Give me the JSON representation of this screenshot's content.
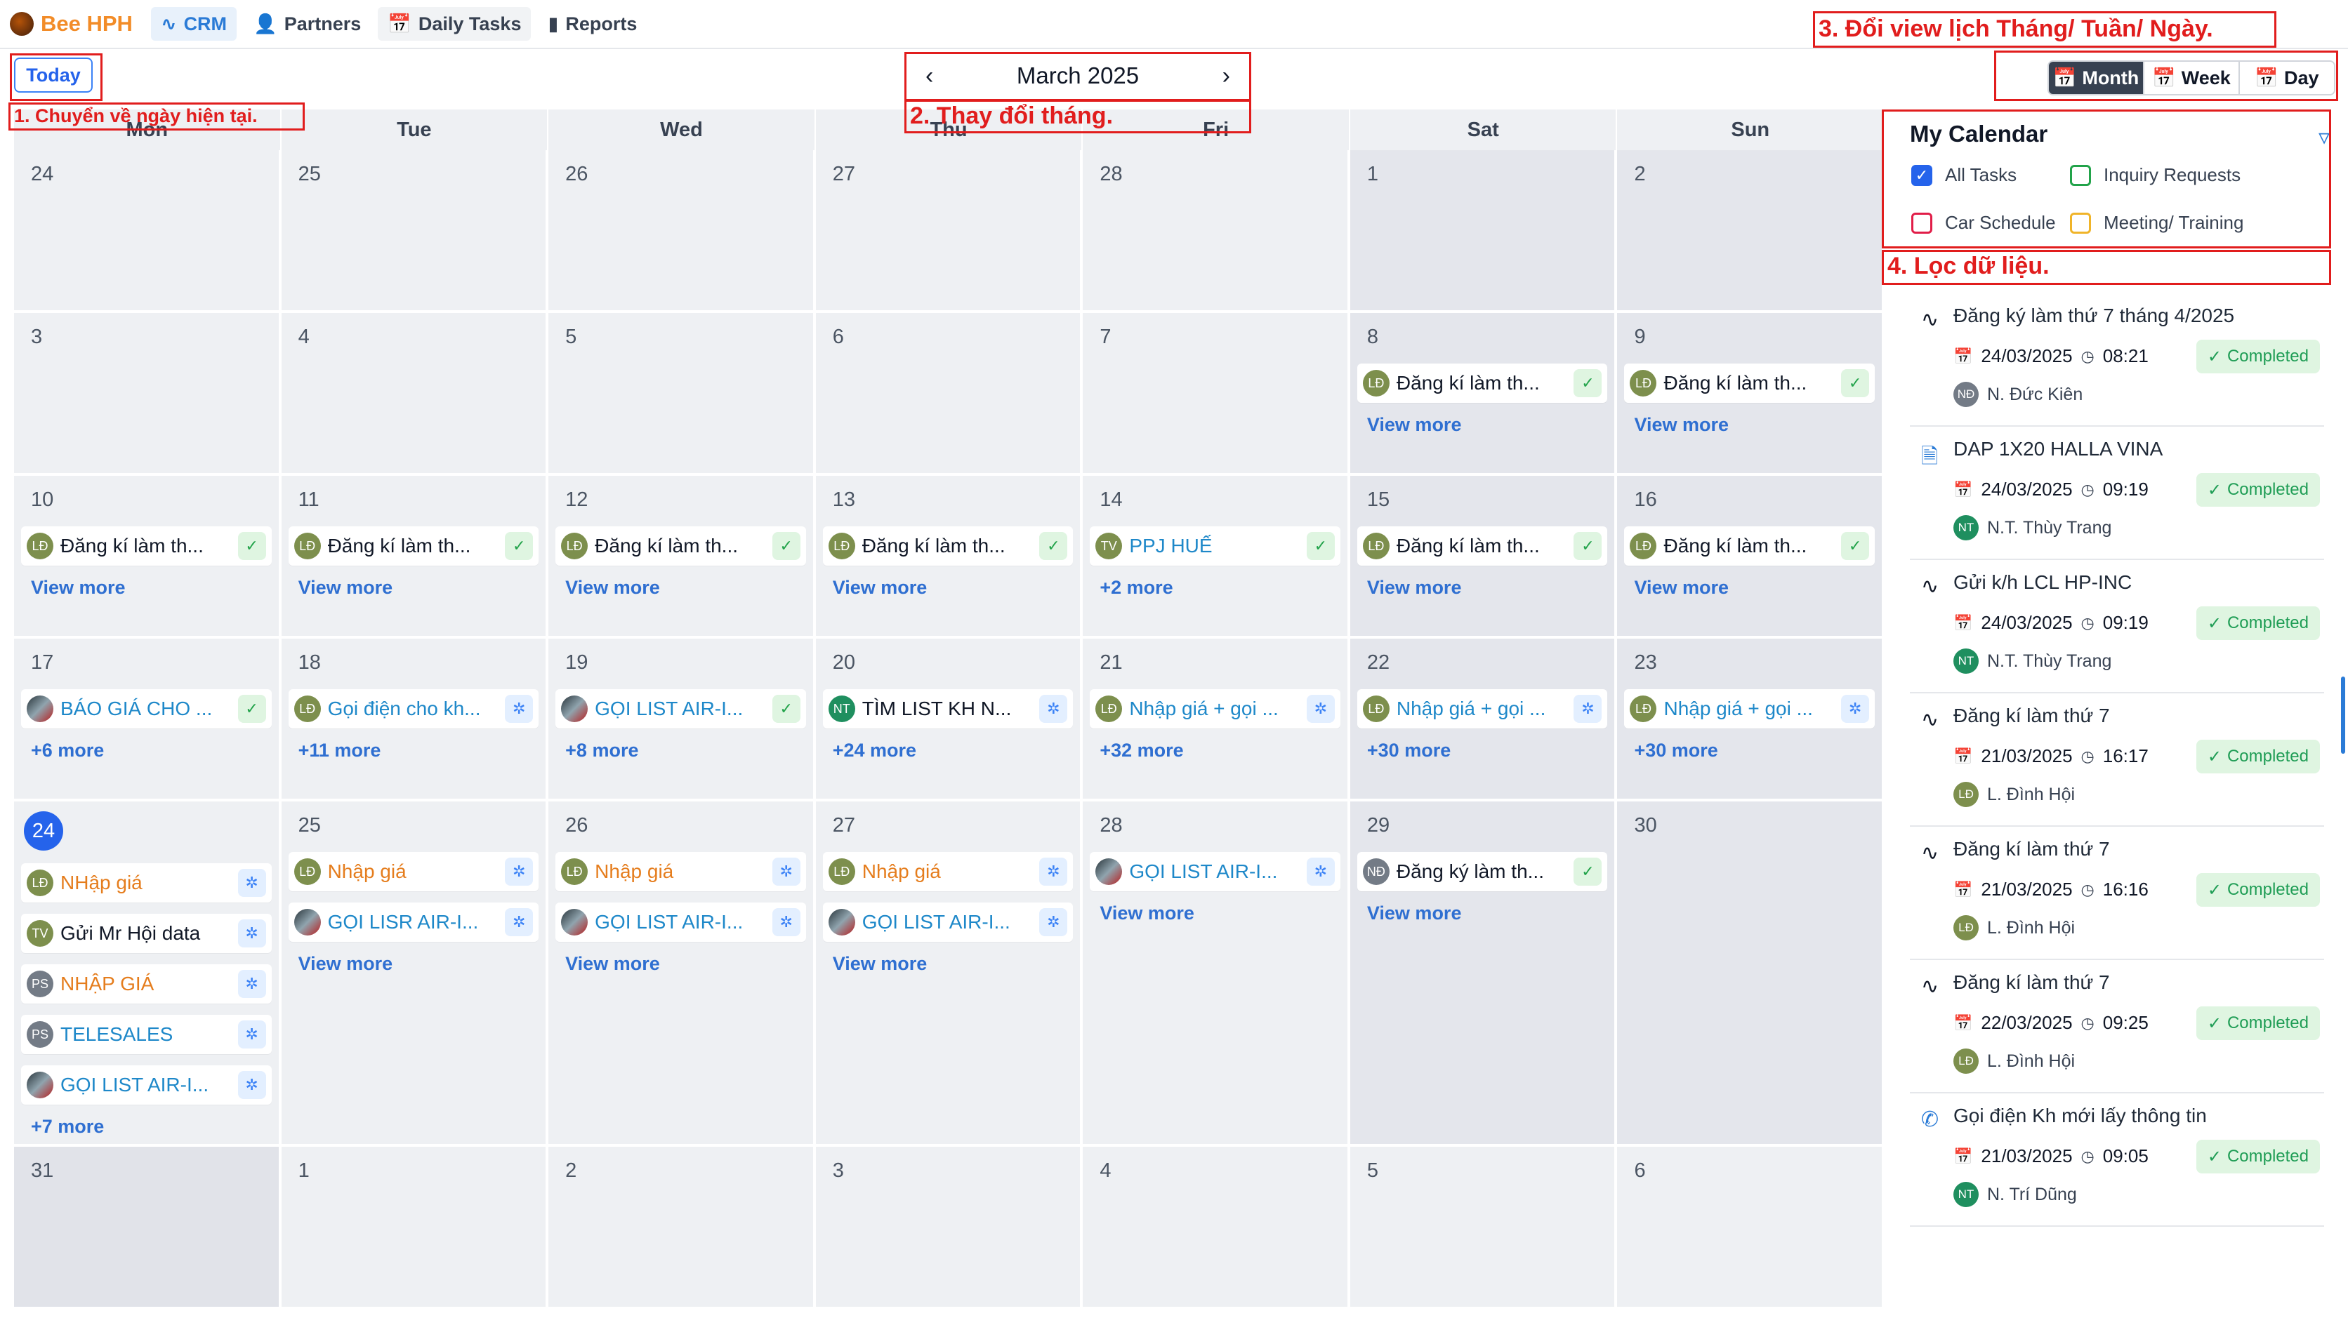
{
  "app": {
    "name": "Bee HPH"
  },
  "nav": [
    {
      "label": "CRM",
      "icon": "activity-icon"
    },
    {
      "label": "Partners",
      "icon": "users-icon"
    },
    {
      "label": "Daily Tasks",
      "icon": "calendar-icon"
    },
    {
      "label": "Reports",
      "icon": "bar-chart-icon"
    }
  ],
  "toolbar": {
    "today_label": "Today",
    "month_label": "March 2025",
    "views": [
      "Month",
      "Week",
      "Day"
    ],
    "active_view": "Month"
  },
  "annotations": {
    "a1": "1. Chuyển về ngày hiện tại.",
    "a2": "2. Thay đổi tháng.",
    "a3": "3. Đổi view lịch Tháng/ Tuần/ Ngày.",
    "a4": "4. Lọc dữ liệu."
  },
  "calendar": {
    "weekdays": [
      "Mon",
      "Tue",
      "Wed",
      "Thu",
      "Fri",
      "Sat",
      "Sun"
    ],
    "weeks": [
      {
        "days": [
          {
            "num": "24",
            "events": []
          },
          {
            "num": "25",
            "events": []
          },
          {
            "num": "26",
            "events": []
          },
          {
            "num": "27",
            "events": []
          },
          {
            "num": "28",
            "events": []
          },
          {
            "num": "1",
            "events": []
          },
          {
            "num": "2",
            "events": []
          }
        ]
      },
      {
        "days": [
          {
            "num": "3",
            "events": []
          },
          {
            "num": "4",
            "events": []
          },
          {
            "num": "5",
            "events": []
          },
          {
            "num": "6",
            "events": []
          },
          {
            "num": "7",
            "events": []
          },
          {
            "num": "8",
            "events": [
              {
                "avatar": "LĐ",
                "title": "Đăng kí làm th...",
                "status": "done"
              }
            ],
            "more": "View more"
          },
          {
            "num": "9",
            "events": [
              {
                "avatar": "LĐ",
                "title": "Đăng kí làm th...",
                "status": "done"
              }
            ],
            "more": "View more"
          }
        ]
      },
      {
        "days": [
          {
            "num": "10",
            "events": [
              {
                "avatar": "LĐ",
                "title": "Đăng kí làm th...",
                "status": "done"
              }
            ],
            "more": "View more"
          },
          {
            "num": "11",
            "events": [
              {
                "avatar": "LĐ",
                "title": "Đăng kí làm th...",
                "status": "done"
              }
            ],
            "more": "View more"
          },
          {
            "num": "12",
            "events": [
              {
                "avatar": "LĐ",
                "title": "Đăng kí làm th...",
                "status": "done"
              }
            ],
            "more": "View more"
          },
          {
            "num": "13",
            "events": [
              {
                "avatar": "LĐ",
                "title": "Đăng kí làm th...",
                "status": "done"
              }
            ],
            "more": "View more"
          },
          {
            "num": "14",
            "events": [
              {
                "avatar": "TV",
                "title": "PPJ HUẾ",
                "status": "done",
                "color": "blue"
              }
            ],
            "more": "+2 more"
          },
          {
            "num": "15",
            "events": [
              {
                "avatar": "LĐ",
                "title": "Đăng kí làm th...",
                "status": "done"
              }
            ],
            "more": "View more"
          },
          {
            "num": "16",
            "events": [
              {
                "avatar": "LĐ",
                "title": "Đăng kí làm th...",
                "status": "done"
              }
            ],
            "more": "View more"
          }
        ]
      },
      {
        "days": [
          {
            "num": "17",
            "events": [
              {
                "avatar": "",
                "photo": true,
                "title": "BÁO GIÁ CHO ...",
                "status": "done",
                "color": "blue"
              }
            ],
            "more": "+6 more"
          },
          {
            "num": "18",
            "events": [
              {
                "avatar": "LĐ",
                "title": "Gọi điện cho kh...",
                "status": "pending",
                "color": "blue"
              }
            ],
            "more": "+11 more"
          },
          {
            "num": "19",
            "events": [
              {
                "avatar": "",
                "photo": true,
                "title": "GỌI LIST AIR-I...",
                "status": "done",
                "color": "blue"
              }
            ],
            "more": "+8 more"
          },
          {
            "num": "20",
            "events": [
              {
                "avatar": "NT",
                "avatarColor": "teal",
                "title": "TÌM LIST KH N...",
                "status": "pending"
              }
            ],
            "more": "+24 more"
          },
          {
            "num": "21",
            "events": [
              {
                "avatar": "LĐ",
                "title": "Nhập giá + gọi ...",
                "status": "pending",
                "color": "blue"
              }
            ],
            "more": "+32 more"
          },
          {
            "num": "22",
            "events": [
              {
                "avatar": "LĐ",
                "title": "Nhập giá + gọi ...",
                "status": "pending",
                "color": "blue"
              }
            ],
            "more": "+30 more"
          },
          {
            "num": "23",
            "events": [
              {
                "avatar": "LĐ",
                "title": "Nhập giá + gọi ...",
                "status": "pending",
                "color": "blue"
              }
            ],
            "more": "+30 more"
          }
        ]
      },
      {
        "days": [
          {
            "num": "24",
            "today": true,
            "events": [
              {
                "avatar": "LĐ",
                "title": "NHập giá",
                "status": "pending",
                "color": "orange"
              },
              {
                "avatar": "TV",
                "title": "Gửi Mr Hội data",
                "status": "pending"
              },
              {
                "avatar": "PS",
                "avatarColor": "gray",
                "title": "NHẬP GIÁ",
                "status": "pending",
                "color": "orange"
              },
              {
                "avatar": "PS",
                "avatarColor": "gray",
                "title": "TELESALES",
                "status": "pending",
                "color": "blue"
              },
              {
                "avatar": "",
                "photo": true,
                "title": "GỌI LIST AIR-I...",
                "status": "pending",
                "color": "blue"
              }
            ],
            "more": "+7 more"
          },
          {
            "num": "25",
            "events": [
              {
                "avatar": "LĐ",
                "title": "Nhập giá",
                "status": "pending",
                "color": "orange"
              },
              {
                "avatar": "",
                "photo": true,
                "title": "GỌI LISR AIR-I...",
                "status": "pending",
                "color": "blue"
              }
            ],
            "more": "View more"
          },
          {
            "num": "26",
            "events": [
              {
                "avatar": "LĐ",
                "title": "Nhập giá",
                "status": "pending",
                "color": "orange"
              },
              {
                "avatar": "",
                "photo": true,
                "title": "GỌI LIST AIR-I...",
                "status": "pending",
                "color": "blue"
              }
            ],
            "more": "View more"
          },
          {
            "num": "27",
            "events": [
              {
                "avatar": "LĐ",
                "title": "Nhập giá",
                "status": "pending",
                "color": "orange"
              },
              {
                "avatar": "",
                "photo": true,
                "title": "GỌI LIST AIR-I...",
                "status": "pending",
                "color": "blue"
              }
            ],
            "more": "View more"
          },
          {
            "num": "28",
            "events": [
              {
                "avatar": "",
                "photo": true,
                "title": "GỌI LIST AIR-I...",
                "status": "pending",
                "color": "blue"
              }
            ],
            "more": "View more"
          },
          {
            "num": "29",
            "events": [
              {
                "avatar": "NĐ",
                "avatarColor": "gray",
                "title": "Đăng ký làm th...",
                "status": "done"
              }
            ],
            "more": "View more"
          },
          {
            "num": "30",
            "events": []
          }
        ]
      },
      {
        "days": [
          {
            "num": "31",
            "events": []
          },
          {
            "num": "1",
            "events": []
          },
          {
            "num": "2",
            "events": []
          },
          {
            "num": "3",
            "events": []
          },
          {
            "num": "4",
            "events": []
          },
          {
            "num": "5",
            "events": []
          },
          {
            "num": "6",
            "events": []
          }
        ]
      }
    ]
  },
  "panel": {
    "title": "My Calendar",
    "filters": [
      {
        "label": "All Tasks",
        "checked": true,
        "color": "blue"
      },
      {
        "label": "Inquiry Requests",
        "checked": false,
        "color": "green"
      },
      {
        "label": "Car Schedule",
        "checked": false,
        "color": "red"
      },
      {
        "label": "Meeting/ Training",
        "checked": false,
        "color": "yellow"
      }
    ],
    "tasks": [
      {
        "icon": "activity-icon",
        "title": "Đăng ký làm thứ 7 tháng 4/2025",
        "date": "24/03/2025",
        "time": "08:21",
        "status": "Completed",
        "avatar": "NĐ",
        "avatarColor": "gray",
        "user": "N. Đức Kiên"
      },
      {
        "icon": "document-icon",
        "title": "DAP 1X20 HALLA VINA",
        "date": "24/03/2025",
        "time": "09:19",
        "status": "Completed",
        "avatar": "NT",
        "avatarColor": "teal",
        "user": "N.T. Thùy Trang"
      },
      {
        "icon": "activity-icon",
        "title": "Gửi k/h LCL HP-INC",
        "date": "24/03/2025",
        "time": "09:19",
        "status": "Completed",
        "avatar": "NT",
        "avatarColor": "teal",
        "user": "N.T. Thùy Trang"
      },
      {
        "icon": "activity-icon",
        "title": "Đăng kí làm thứ 7",
        "date": "21/03/2025",
        "time": "16:17",
        "status": "Completed",
        "avatar": "LĐ",
        "avatarColor": "olive",
        "user": "L. Đình Hội"
      },
      {
        "icon": "activity-icon",
        "title": "Đăng kí làm thứ 7",
        "date": "21/03/2025",
        "time": "16:16",
        "status": "Completed",
        "avatar": "LĐ",
        "avatarColor": "olive",
        "user": "L. Đình Hội"
      },
      {
        "icon": "activity-icon",
        "title": "Đăng kí làm thứ 7",
        "date": "22/03/2025",
        "time": "09:25",
        "status": "Completed",
        "avatar": "LĐ",
        "avatarColor": "olive",
        "user": "L. Đình Hội"
      },
      {
        "icon": "phone-icon",
        "title": "Gọi điện Kh mới lấy thông tin",
        "date": "21/03/2025",
        "time": "09:05",
        "status": "Completed",
        "avatar": "NT",
        "avatarColor": "teal",
        "user": "N. Trí Dũng"
      }
    ]
  }
}
